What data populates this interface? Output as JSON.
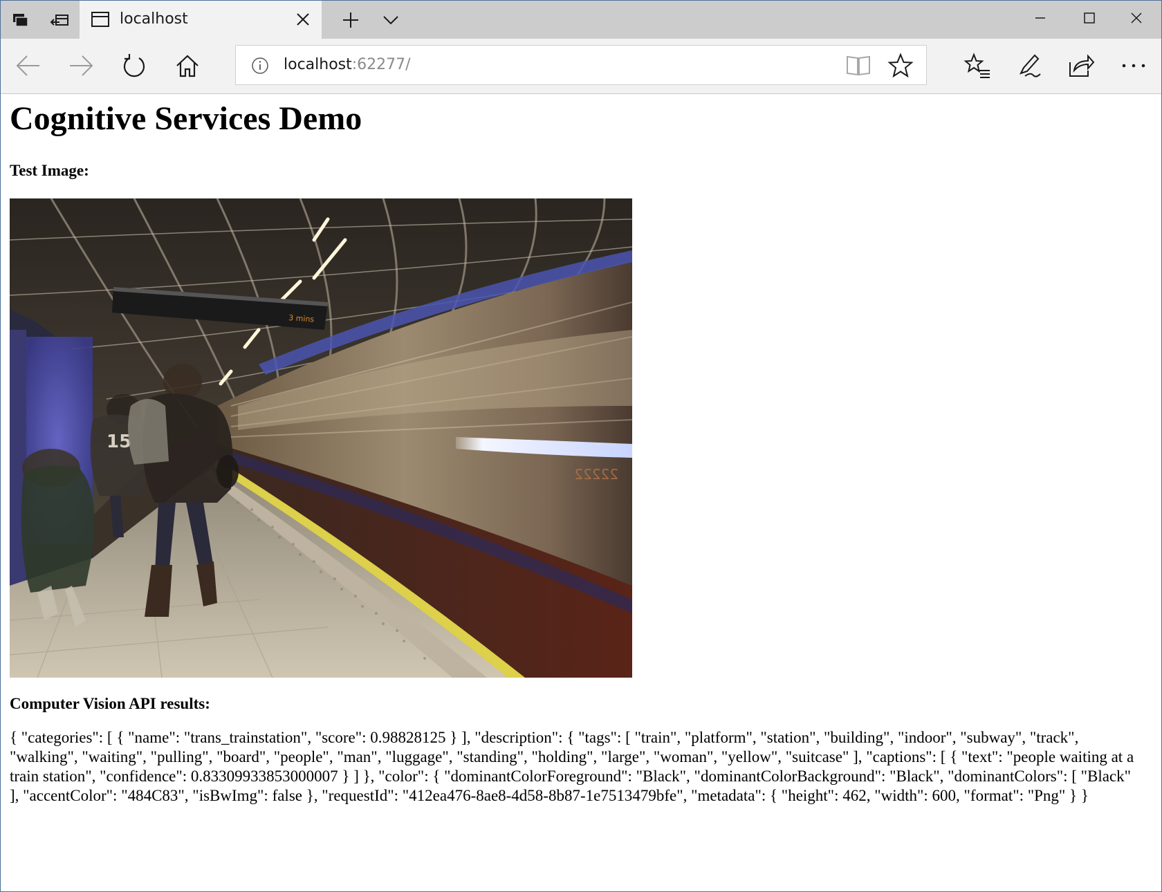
{
  "browser": {
    "tab": {
      "title": "localhost",
      "page_icon": "page-icon",
      "close_icon": "close-icon"
    },
    "tab_buttons": {
      "tab_list_icon": "tab-list-icon",
      "set_aside_icon": "set-aside-tabs-icon",
      "new_tab_icon": "plus-icon",
      "tab_preview_icon": "chevron-down-icon"
    },
    "window_controls": {
      "minimize_icon": "minimize-icon",
      "maximize_icon": "maximize-icon",
      "close_icon": "close-icon"
    },
    "nav": {
      "back_icon": "arrow-left-icon",
      "forward_icon": "arrow-right-icon",
      "refresh_icon": "refresh-icon",
      "home_icon": "home-icon"
    },
    "address": {
      "host": "localhost",
      "port": ":62277/",
      "info_icon": "info-icon",
      "reading_view_icon": "book-icon",
      "favorite_icon": "star-icon"
    },
    "toolbar": {
      "favorites_hub_icon": "favorites-list-icon",
      "web_note_icon": "pen-icon",
      "share_icon": "share-icon",
      "more_icon": "ellipsis-icon"
    }
  },
  "page": {
    "title": "Cognitive Services Demo",
    "test_image_label": "Test Image:",
    "results_label": "Computer Vision API results:",
    "results_json": "{ \"categories\": [ { \"name\": \"trans_trainstation\", \"score\": 0.98828125 } ], \"description\": { \"tags\": [ \"train\", \"platform\", \"station\", \"building\", \"indoor\", \"subway\", \"track\", \"walking\", \"waiting\", \"pulling\", \"board\", \"people\", \"man\", \"luggage\", \"standing\", \"holding\", \"large\", \"woman\", \"yellow\", \"suitcase\" ], \"captions\": [ { \"text\": \"people waiting at a train station\", \"confidence\": 0.83309933853000007 } ] }, \"color\": { \"dominantColorForeground\": \"Black\", \"dominantColorBackground\": \"Black\", \"dominantColors\": [ \"Black\" ], \"accentColor\": \"484C83\", \"isBwImg\": false }, \"requestId\": \"412ea476-8ae8-4d58-8b87-1e7513479bfe\", \"metadata\": { \"height\": 462, \"width\": 600, \"format\": \"Png\" } }"
  },
  "photo": {
    "departure_board_text": "3 mins",
    "train_number_text": "22222"
  },
  "colors": {
    "titlebar": "#cccccc",
    "tab_active": "#f2f2f2",
    "navbar": "#f2f2f2",
    "window_border": "#4a6f97",
    "url_port": "#8a8a8a"
  }
}
